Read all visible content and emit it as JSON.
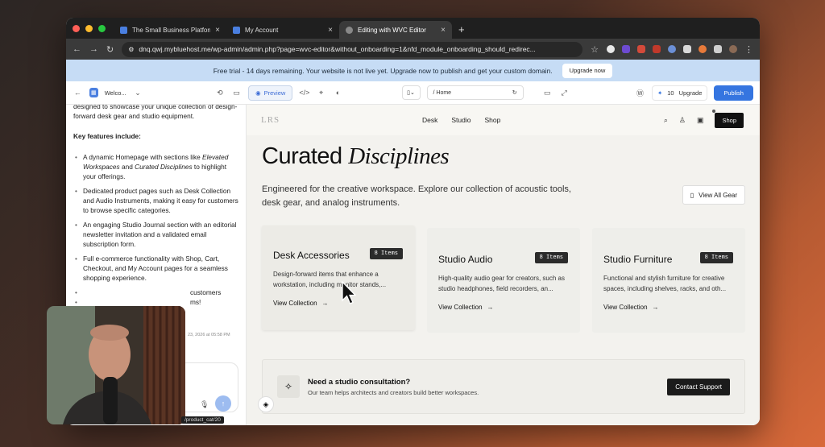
{
  "browser": {
    "tabs": [
      {
        "label": "The Small Business Platform",
        "active": false
      },
      {
        "label": "My Account",
        "active": false
      },
      {
        "label": "Editing with WVC Editor",
        "active": true
      }
    ],
    "url": "dnq.qwj.mybluehost.me/wp-admin/admin.php?page=wvc-editor&without_onboarding=1&nfd_module_onboarding_should_redirec..."
  },
  "banner": {
    "text": "Free trial - 14 days remaining. Your website is not live yet. Upgrade now to publish and get your custom domain.",
    "button": "Upgrade now"
  },
  "toolbar": {
    "site_label": "Welco...",
    "preview_label": "Preview",
    "path": "/ Home",
    "credits": "10",
    "upgrade_label": "Upgrade",
    "publish_label": "Publish"
  },
  "sidebar": {
    "intro": "designed to showcase your unique collection of design-forward desk gear and studio equipment.",
    "heading": "Key features include:",
    "features": [
      {
        "before": "A dynamic Homepage with sections like ",
        "em1": "Elevated Workspaces",
        "mid": " and ",
        "em2": "Curated Disciplines",
        "after": " to highlight your offerings."
      },
      {
        "text": "Dedicated product pages such as Desk Collection and Audio Instruments, making it easy for customers to browse specific categories."
      },
      {
        "text": "An engaging Studio Journal section with an editorial newsletter invitation and a validated email subscription form."
      },
      {
        "text": "Full e-commerce functionality with Shop, Cart, Checkout, and My Account pages for a seamless shopping experience."
      },
      {
        "text": "customers"
      },
      {
        "text": "ms!"
      }
    ],
    "timestamp": "23, 2026 at 05:58 PM"
  },
  "site": {
    "logo": "LRS",
    "nav": [
      "Desk",
      "Studio",
      "Shop"
    ],
    "shop_button": "Shop",
    "heading_plain": "Curated",
    "heading_italic": "Disciplines",
    "lead": "Engineered for the creative workspace. Explore our collection of acoustic tools, desk gear, and analog instruments.",
    "view_all": "View All Gear",
    "cards": [
      {
        "title": "Desk Accessories",
        "badge": "8 Items",
        "desc": "Design-forward items that enhance a workstation, including monitor stands,...",
        "link": "View Collection"
      },
      {
        "title": "Studio Audio",
        "badge": "8 Items",
        "desc": "High-quality audio gear for creators, such as studio headphones, field recorders, an...",
        "link": "View Collection"
      },
      {
        "title": "Studio Furniture",
        "badge": "8 Items",
        "desc": "Functional and stylish furniture for creative spaces, including shelves, racks, and oth...",
        "link": "View Collection"
      }
    ],
    "consult": {
      "title": "Need a studio consultation?",
      "subtitle": "Our team helps architects and creators build better workspaces.",
      "button": "Contact Support"
    }
  },
  "status_caption": "/product_cat/20"
}
